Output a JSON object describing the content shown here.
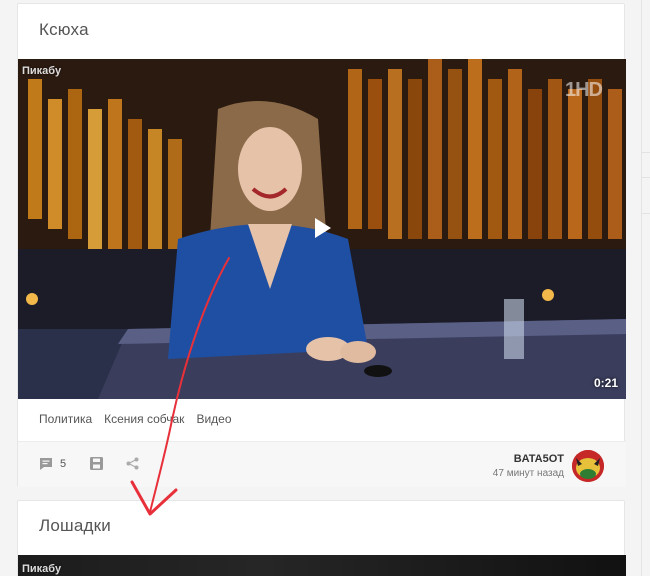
{
  "posts": [
    {
      "title": "Ксюха",
      "video": {
        "watermark": "Пикабу",
        "channel_logo": "1HD",
        "duration": "0:21"
      },
      "tags": [
        "Политика",
        "Ксения собчак",
        "Видео"
      ],
      "footer": {
        "comment_count": "5",
        "author": "BATA5OT",
        "time": "47 минут назад"
      }
    },
    {
      "title": "Лошадки",
      "video": {
        "watermark": "Пикабу"
      }
    }
  ],
  "icons": {
    "comment": "comment-icon",
    "save": "save-icon",
    "share": "share-icon",
    "play": "play-icon"
  },
  "colors": {
    "annotation_arrow": "#e8303a",
    "avatar": "#c62828"
  }
}
